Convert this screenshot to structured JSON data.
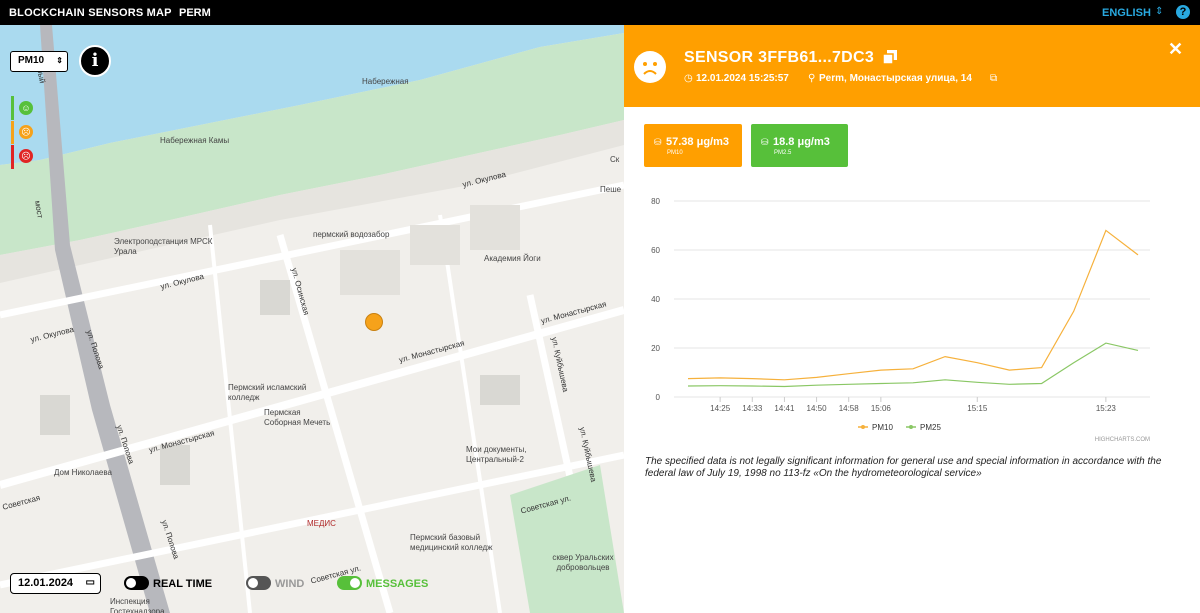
{
  "topbar": {
    "brand": "BLOCKCHAIN SENSORS MAP",
    "city": "PERM",
    "language": "ENGLISH",
    "language_arrow": "⇕",
    "help": "?"
  },
  "map_controls": {
    "pollutant_select": "PM10",
    "info_label": "i",
    "date": "12.01.2024",
    "realtime_label": "REAL TIME",
    "wind_label": "WIND",
    "messages_label": "MESSAGES",
    "realtime_on": false,
    "wind_on": false,
    "messages_on": true
  },
  "map_labels": {
    "places": [
      "Набережная",
      "Набережная Камы",
      "пермский водозабор",
      "Электроподстанция МРСК Урала",
      "Академия Йоги",
      "Пермский исламский колледж",
      "Пермская Соборная Мечеть",
      "Мои документы, Центральный-2",
      "Дом Николаева",
      "МЕДИС",
      "Пермский базовый медицинский колледж",
      "сквер Уральских добровольцев",
      "Инспекция Гостехнадзора",
      "Пеше",
      "Ск"
    ],
    "streets": [
      "ул. Окулова",
      "ул. Окулова",
      "ул. Окулова",
      "ул. Осинская",
      "ул. Монастырская",
      "ул. Монастырская",
      "ул. Монастырская",
      "ул. Попова",
      "ул. Попова",
      "ул. Попова",
      "ул. Куйбышева",
      "ул. Куйбышева",
      "Советская ул.",
      "Советская ул.",
      "Советская",
      "мост",
      "альный"
    ]
  },
  "panel": {
    "sensor_title": "SENSOR 3FFB61...7DC3",
    "timestamp": "12.01.2024 15:25:57",
    "address": "Perm, Монастырская улица, 14",
    "close_label": "✕",
    "readings": [
      {
        "value": "57.38 μg/m3",
        "label": "PM10",
        "color": "#ff9f00"
      },
      {
        "value": "18.8 μg/m3",
        "label": "PM2.5",
        "color": "#57c03a"
      }
    ],
    "disclaimer": "The specified data is not legally significant information for general use and special information in accordance with the federal law of July 19, 1998 no 113-fz «On the hydrometeorological service»"
  },
  "colors": {
    "accent_orange": "#ff9f00",
    "accent_green": "#57c03a",
    "link_blue": "#29a9e0",
    "status_good": "#57c03a",
    "status_medium": "#f6a21a",
    "status_bad": "#e02424"
  },
  "chart_data": {
    "type": "line",
    "x": [
      "14:20",
      "14:25",
      "14:33",
      "14:41",
      "14:50",
      "14:58",
      "15:06",
      "15:10",
      "15:13",
      "15:15",
      "15:18",
      "15:20",
      "15:21",
      "15:23",
      "15:25"
    ],
    "x_ticks": [
      "14:25",
      "14:33",
      "14:41",
      "14:50",
      "14:58",
      "15:06",
      "15:15",
      "15:23"
    ],
    "y_ticks": [
      "0",
      "20",
      "40",
      "60",
      "80"
    ],
    "ylim": [
      0,
      80
    ],
    "series": [
      {
        "name": "PM10",
        "color": "#f6b13c",
        "values": [
          7.5,
          7.8,
          7.5,
          7.0,
          8.0,
          9.5,
          11.0,
          11.5,
          16.5,
          14.0,
          11.0,
          12.0,
          35.0,
          68.0,
          58.0
        ]
      },
      {
        "name": "PM25",
        "color": "#8ac765",
        "values": [
          4.5,
          4.6,
          4.5,
          4.3,
          4.8,
          5.2,
          5.5,
          5.8,
          7.0,
          6.0,
          5.2,
          5.5,
          14.0,
          22.0,
          19.0
        ]
      }
    ],
    "legend": [
      "PM10",
      "PM25"
    ],
    "credits": "HIGHCHARTS.COM",
    "grid": true,
    "legend_position": "bottom-center"
  }
}
